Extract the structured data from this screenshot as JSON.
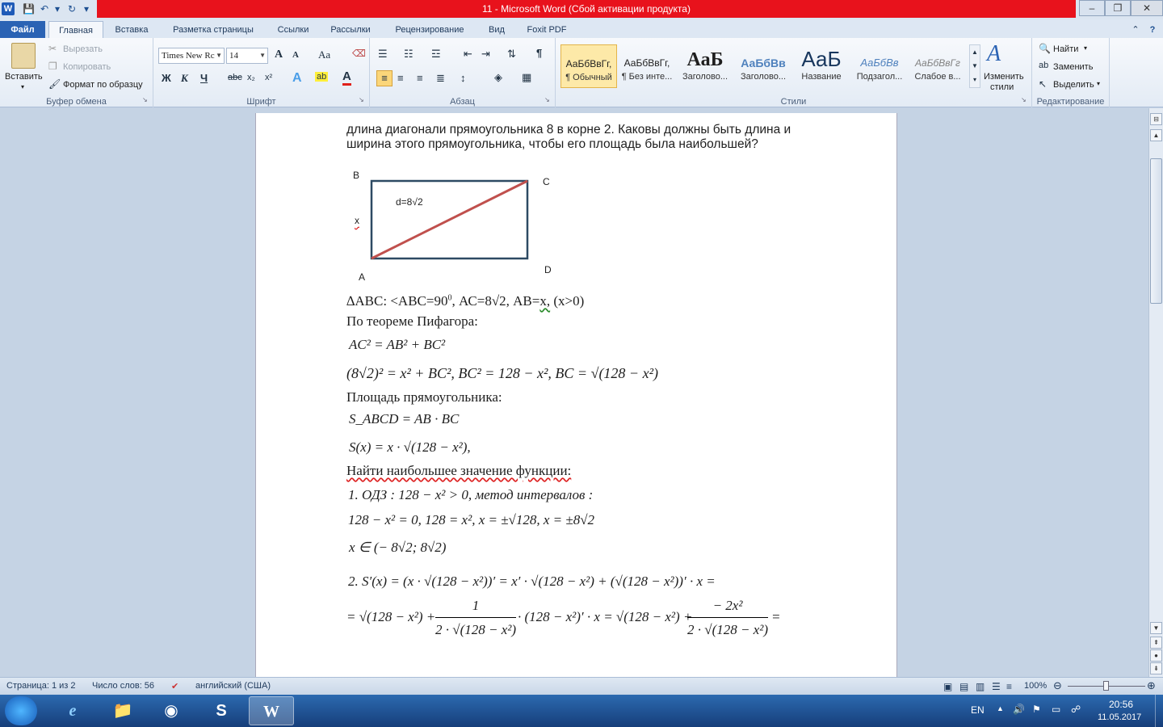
{
  "window": {
    "title": "11  -  Microsoft Word (Сбой активации продукта)",
    "word_logo": "W",
    "minimize": "–",
    "maximize": "❐",
    "close": "✕"
  },
  "tabs": [
    "Файл",
    "Главная",
    "Вставка",
    "Разметка страницы",
    "Ссылки",
    "Рассылки",
    "Рецензирование",
    "Вид",
    "Foxit PDF"
  ],
  "ribbon": {
    "clipboard": {
      "label": "Буфер обмена",
      "paste": "Вставить",
      "cut": "Вырезать",
      "copy": "Копировать",
      "format_painter": "Формат по образцу"
    },
    "font": {
      "label": "Шрифт",
      "font_name": "Times New Rc",
      "font_size": "14",
      "bold": "Ж",
      "italic": "К",
      "underline": "Ч",
      "strike": "abc",
      "subscript": "x₂",
      "superscript": "x²",
      "grow": "A",
      "shrink": "A",
      "case": "Aa",
      "highlight": "ab",
      "color_a": "A",
      "effects_a": "A"
    },
    "paragraph": {
      "label": "Абзац"
    },
    "styles": {
      "label": "Стили",
      "items": [
        {
          "preview": "АаБбВвГг,",
          "name": "¶ Обычный"
        },
        {
          "preview": "АаБбВвГг,",
          "name": "¶ Без инте..."
        },
        {
          "preview": "АаБ",
          "name": "Заголово..."
        },
        {
          "preview": "АаБбВв",
          "name": "Заголово..."
        },
        {
          "preview": "АаБ",
          "name": "Название"
        },
        {
          "preview": "АаБбВв",
          "name": "Подзагол..."
        },
        {
          "preview": "АаБбВвГг",
          "name": "Слабое в..."
        }
      ],
      "change_styles_1": "Изменить",
      "change_styles_2": "стили"
    },
    "editing": {
      "label": "Редактирование",
      "find": "Найти",
      "replace": "Заменить",
      "select": "Выделить"
    }
  },
  "document": {
    "intro_line1": "длина диагонали прямоугольника 8 в корне 2. Каковы должны быть длина и",
    "intro_line2": "ширина этого прямоугольника, чтобы его площадь была наибольшей?",
    "figure": {
      "vertex_b": "B",
      "vertex_c": "C",
      "vertex_a": "A",
      "vertex_d": "D",
      "side_x": "x",
      "diagonal": "d=8√2"
    },
    "triangle_line_a": "∆АВС:  <АВС=90",
    "triangle_deg": "0",
    "triangle_line_b": ", АС=8√2, АВ=",
    "triangle_x": "х,",
    "triangle_line_c": "  (х>0)",
    "pythagoras_title": "По теореме Пифагора:",
    "eq1": "AC² = AB² + BC²",
    "eq2": "(8√2)² = x² + BC²,    BC² = 128 − x²,    BC = √(128 − x²)",
    "area_title": "Площадь прямоугольника:",
    "eq3": "S_ABCD = AB · BC",
    "eq4": "S(x) = x · √(128 − x²),",
    "find_max": "Найти наибольшее значение функции:",
    "step1": "1.    ОДЗ :    128 − x² > 0, метод интервалов :",
    "eq5": "128 − x² = 0,    128 = x²,    x = ±√128,    x = ±8√2",
    "eq6": "x ∈ (− 8√2; 8√2)",
    "step2": "2.    S′(x) = (x · √(128 − x²))′ = x′ · √(128 − x²) + (√(128 − x²))′ · x =",
    "eq7_a": "= √(128 − x²) +",
    "eq7_num1": "1",
    "eq7_den1": "2 · √(128 − x²)",
    "eq7_b": "· (128 − x²)′ · x = √(128 − x²) +",
    "eq7_num2": "− 2x²",
    "eq7_den2": "2 · √(128 − x²)",
    "eq7_c": "="
  },
  "statusbar": {
    "page": "Страница: 1 из 2",
    "words": "Число слов: 56",
    "language": "английский (США)",
    "zoom": "100%"
  },
  "taskbar": {
    "lang": "EN",
    "time": "20:56",
    "date": "11.05.2017"
  },
  "colors": {
    "title_red": "#e8121c",
    "file_tab": "#2b63b4",
    "rect_stroke": "#2d4a63",
    "diagonal": "#c0504d"
  }
}
